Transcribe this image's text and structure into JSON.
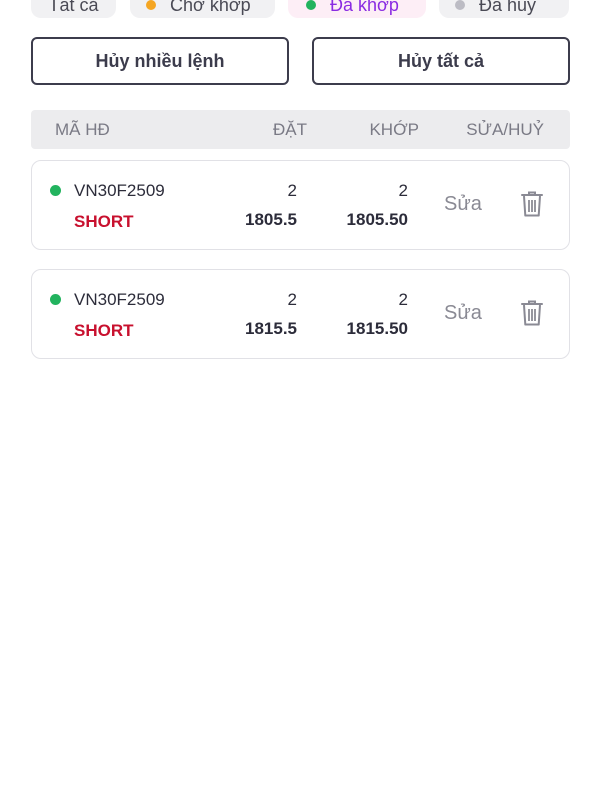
{
  "filters": {
    "all": {
      "label": "Tất cả"
    },
    "pending": {
      "label": "Chờ khớp",
      "dot_color": "#f5a623"
    },
    "matched": {
      "label": "Đã khớp",
      "dot_color": "#22b35e"
    },
    "cancelled": {
      "label": "Đã hủy",
      "dot_color": "#bcbcc4"
    }
  },
  "actions": {
    "cancel_multiple": "Hủy nhiều lệnh",
    "cancel_all": "Hủy tất cả"
  },
  "table": {
    "headers": {
      "code": "MÃ HĐ",
      "order": "ĐẶT",
      "matched": "KHỚP",
      "edit_cancel": "SỬA/HUỶ"
    },
    "rows": [
      {
        "status_color": "#22b35e",
        "code": "VN30F2509",
        "side": "SHORT",
        "side_color": "#c8102e",
        "order_qty": "2",
        "order_price": "1805.5",
        "matched_qty": "2",
        "matched_price": "1805.50",
        "edit_label": "Sửa",
        "delete_icon": "trash-icon"
      },
      {
        "status_color": "#22b35e",
        "code": "VN30F2509",
        "side": "SHORT",
        "side_color": "#c8102e",
        "order_qty": "2",
        "order_price": "1815.5",
        "matched_qty": "2",
        "matched_price": "1815.50",
        "edit_label": "Sửa",
        "delete_icon": "trash-icon"
      }
    ]
  }
}
